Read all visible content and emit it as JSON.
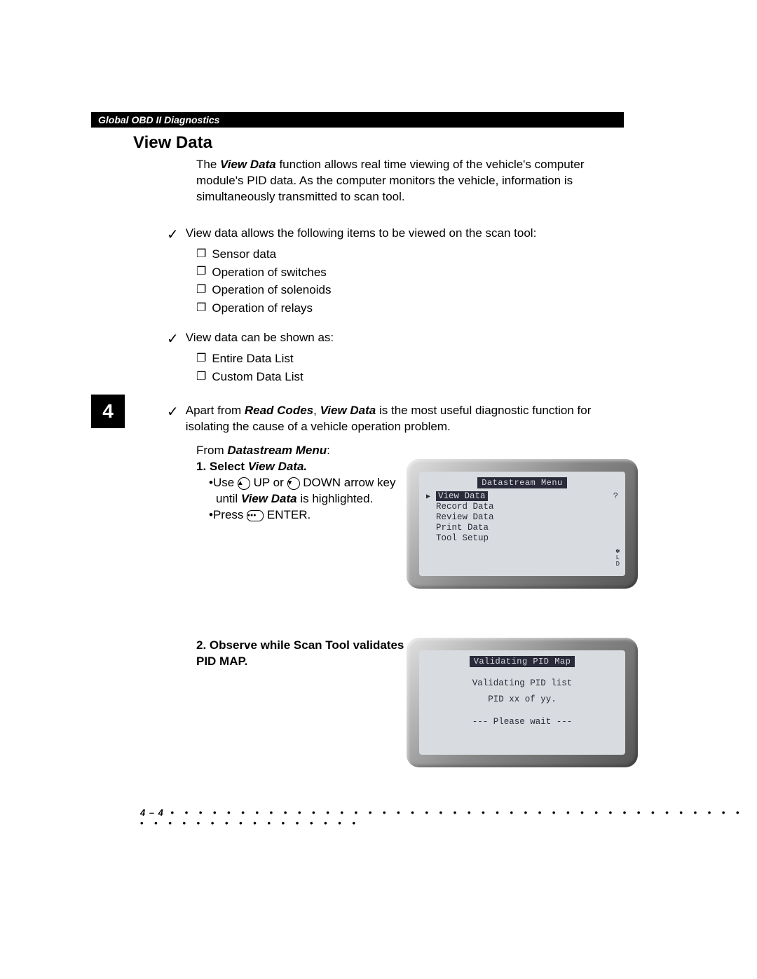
{
  "header": "Global OBD II Diagnostics",
  "section_title": "View Data",
  "intro_prefix": "The ",
  "intro_em": "View Data",
  "intro_rest": " function allows real time viewing of the vehicle's computer module's PID data. As the computer monitors the vehicle, information is simultaneously transmitted to scan tool.",
  "check1": "View data allows the following items to be viewed on the scan tool:",
  "list1": [
    "Sensor data",
    "Operation of switches",
    "Operation of solenoids",
    "Operation of relays"
  ],
  "check2": "View data can be shown as:",
  "list2": [
    "Entire Data List",
    "Custom Data List"
  ],
  "check3_pre": "Apart from ",
  "check3_em1": "Read Codes",
  "check3_mid": ", ",
  "check3_em2": "View Data",
  "check3_rest": " is the most useful diagnostic function for isolating the cause of a vehicle operation problem.",
  "chapter_num": "4",
  "from_pre": "From ",
  "from_em": "Datastream Menu",
  "from_post": ":",
  "step1_num": "1.",
  "step1_label_pre": "Select ",
  "step1_label_em": "View Data.",
  "step1_sub1_pre": "Use ",
  "step1_sub1_up": " UP or ",
  "step1_sub1_down": " DOWN arrow key until ",
  "step1_sub1_em": "View Data",
  "step1_sub1_post": " is highlighted.",
  "step1_sub2_pre": "Press ",
  "step1_sub2_post": " ENTER.",
  "screen1": {
    "title": "Datastream Menu",
    "items": [
      "View Data",
      "Record Data",
      "Review Data",
      "Print Data",
      "Tool Setup"
    ],
    "q": "?",
    "side": "✽\nL\nD"
  },
  "step2_num": "2.",
  "step2_label": "Observe while Scan Tool validates PID MAP.",
  "screen2": {
    "title": "Validating PID Map",
    "line1": "Validating PID list",
    "line2": "PID xx of yy.",
    "line3": "--- Please wait ---"
  },
  "footer_page": "4 – 4",
  "footer_dots": " • • • • • • • • • • • • • • • • • • • • • • • • • • • • • • • • • • • • • • • • • • • • • • • • • • • • • • • • •"
}
